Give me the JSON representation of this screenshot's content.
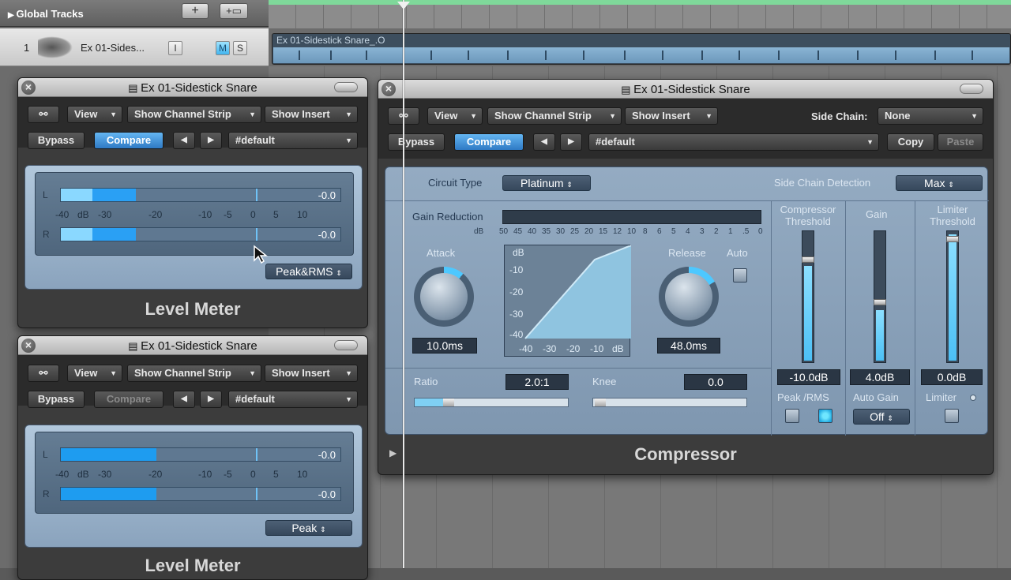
{
  "arrange": {
    "global_tracks": "Global Tracks",
    "add_btn": "+",
    "folder_btn": "+▭",
    "track": {
      "number": "1",
      "name": "Ex 01-Sides...",
      "i": "I",
      "m": "M",
      "s": "S"
    },
    "region_name": "Ex 01-Sidestick Snare_.O"
  },
  "lm1": {
    "title": "Ex 01-Sidestick Snare",
    "link": "⚯",
    "view": "View",
    "show_channel_strip": "Show Channel Strip",
    "show_insert": "Show Insert",
    "bypass": "Bypass",
    "compare": "Compare",
    "prev": "◀",
    "next": "▶",
    "preset": "#default",
    "ch_l": "L",
    "ch_r": "R",
    "val_l": "-0.0",
    "val_r": "-0.0",
    "scale": [
      "-40",
      "dB",
      "-30",
      "-20",
      "-10",
      "-5",
      "0",
      "5",
      "10"
    ],
    "mode": "Peak&RMS",
    "plugin_name": "Level Meter"
  },
  "lm2": {
    "title": "Ex 01-Sidestick Snare",
    "link": "⚯",
    "view": "View",
    "show_channel_strip": "Show Channel Strip",
    "show_insert": "Show Insert",
    "bypass": "Bypass",
    "compare": "Compare",
    "prev": "◀",
    "next": "▶",
    "preset": "#default",
    "ch_l": "L",
    "ch_r": "R",
    "val_l": "-0.0",
    "val_r": "-0.0",
    "scale": [
      "-40",
      "dB",
      "-30",
      "-20",
      "-10",
      "-5",
      "0",
      "5",
      "10"
    ],
    "mode": "Peak",
    "plugin_name": "Level Meter"
  },
  "comp": {
    "title": "Ex 01-Sidestick Snare",
    "link": "⚯",
    "view": "View",
    "show_channel_strip": "Show Channel Strip",
    "show_insert": "Show Insert",
    "side_chain_label": "Side Chain:",
    "side_chain_value": "None",
    "bypass": "Bypass",
    "compare": "Compare",
    "prev": "◀",
    "next": "▶",
    "preset": "#default",
    "copy": "Copy",
    "paste": "Paste",
    "circuit_type_label": "Circuit Type",
    "circuit_type_value": "Platinum",
    "sc_detection_label": "Side Chain Detection",
    "sc_detection_value": "Max",
    "gain_reduction_label": "Gain Reduction",
    "gr_scale": [
      "dB",
      "50",
      "45",
      "40",
      "35",
      "30",
      "25",
      "20",
      "15",
      "12",
      "10",
      "8",
      "6",
      "5",
      "4",
      "3",
      "2",
      "1",
      ".5",
      "0"
    ],
    "attack_label": "Attack",
    "attack_value": "10.0ms",
    "release_label": "Release",
    "release_value": "48.0ms",
    "auto_label": "Auto",
    "graph_y": [
      "dB",
      "-10",
      "-20",
      "-30",
      "-40"
    ],
    "graph_x": [
      "-40",
      "-30",
      "-20",
      "-10",
      "dB"
    ],
    "ratio_label": "Ratio",
    "ratio_value": "2.0:1",
    "knee_label": "Knee",
    "knee_value": "0.0",
    "threshold_label": "Compressor Threshold",
    "threshold_value": "-10.0dB",
    "gain_label": "Gain",
    "gain_value": "4.0dB",
    "limiter_threshold_label": "Limiter Threshold",
    "limiter_threshold_value": "0.0dB",
    "peak_rms_label": "Peak /RMS",
    "auto_gain_label": "Auto Gain",
    "auto_gain_value": "Off",
    "limiter_label": "Limiter",
    "play": "▶",
    "plugin_name": "Compressor"
  },
  "colors": {
    "accent_blue": "#2aa0f4",
    "meter_light": "#8ad8ff",
    "panel_blue": "#8aa3bd"
  }
}
